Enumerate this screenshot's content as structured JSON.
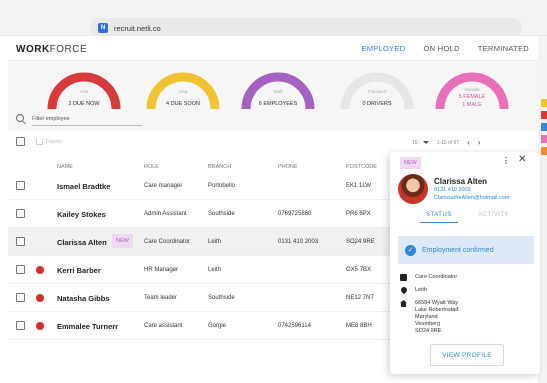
{
  "browser": {
    "url": "recruit.netli.co",
    "site_icon": "netlify-icon"
  },
  "app": {
    "logo_bold": "WORK",
    "logo_rest": "FORCE",
    "nav": [
      {
        "label": "EMPLOYED",
        "active": true
      },
      {
        "label": "ON HOLD",
        "active": false
      },
      {
        "label": "TERMINATED",
        "active": false
      }
    ]
  },
  "gauges": [
    {
      "title": "Visa",
      "value": "2 DUE NOW",
      "color": "#d83a3a",
      "fill": 1.0
    },
    {
      "title": "Visa",
      "value": "4 DUE SOON",
      "color": "#f1c232",
      "fill": 1.0
    },
    {
      "title": "Staff",
      "value": "6  EMPLOYEES",
      "color": "#a560c4",
      "fill": 1.0
    },
    {
      "title": "Transport",
      "value": "0 DRIVERS",
      "color": "#e6e6e6",
      "fill": 1.0
    },
    {
      "title": "Gender",
      "value": "5 FEMALE",
      "value2": "1 MALE",
      "color": "#e870b8",
      "fill": 1.0
    }
  ],
  "filter": {
    "placeholder": "Filter employee"
  },
  "toolbar": {
    "export_label": "Export",
    "page_size": "10",
    "range": "1-10 of 67"
  },
  "table": {
    "headers": {
      "name": "NAME",
      "role": "ROLE",
      "branch": "BRANCH",
      "phone": "PHONE",
      "postcode": "POSTCODE"
    },
    "rows": [
      {
        "name": "Ismael Bradtke",
        "role": "Care manager",
        "branch": "Portobello",
        "phone": "",
        "postcode": "EK1 1LW",
        "alert": false,
        "new": false
      },
      {
        "name": "Kailey Stokes",
        "role": "Admin Assistant",
        "branch": "Southside",
        "phone": "0769725860",
        "postcode": "PR6 6PX",
        "alert": false,
        "new": false
      },
      {
        "name": "Clarissa Alten",
        "role": "Care Coordinator",
        "branch": "Leith",
        "phone": "0131 410 2003",
        "postcode": "SO24 9RE",
        "alert": false,
        "new": true
      },
      {
        "name": "Kerri Barber",
        "role": "HR Manager",
        "branch": "Leith",
        "phone": "",
        "postcode": "OX5 7BX",
        "alert": true,
        "new": false
      },
      {
        "name": "Natasha Gibbs",
        "role": "Team leader",
        "branch": "Southside",
        "phone": "",
        "postcode": "NE12 7NT",
        "alert": true,
        "new": false
      },
      {
        "name": "Emmalee Turnerr",
        "role": "Care assistant",
        "branch": "Gorgie",
        "phone": "0742596114",
        "postcode": "ME8 8BH",
        "alert": true,
        "new": false
      }
    ],
    "new_label": "NEW"
  },
  "panel": {
    "badge": "NEW",
    "more": "⋮",
    "close": "✕",
    "name": "Clarissa Alten",
    "phone": "0131 410 2003",
    "email": "ClarissatheAlten@hotmail.com",
    "tabs": [
      {
        "label": "STATUS",
        "active": true
      },
      {
        "label": "ACTIVITY",
        "active": false
      }
    ],
    "confirm": "Employment confirmed",
    "role": "Care Coordinator",
    "branch": "Leith",
    "address": [
      "66584 Wyatt Way",
      "Lake Robertostad",
      "Maryland",
      "Veumberg",
      "SO24 9RE"
    ],
    "button": "VIEW PROFILE"
  }
}
